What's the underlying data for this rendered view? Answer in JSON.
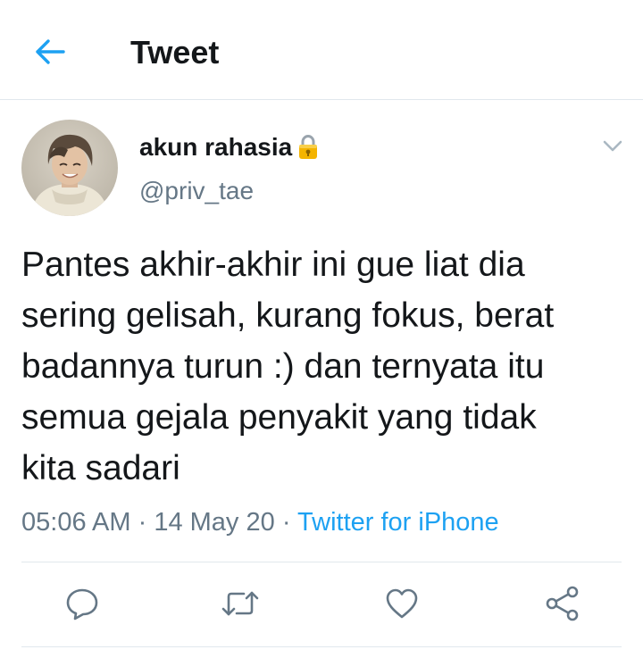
{
  "header": {
    "title": "Tweet",
    "back_icon": "arrow-left-icon"
  },
  "tweet": {
    "author": {
      "display_name": "akun rahasia",
      "username": "@priv_tae",
      "badge_icon": "lock-emoji-icon"
    },
    "text": "Pantes akhir-akhir ini gue liat dia\nsering gelisah, kurang fokus, berat\nbadannya turun :) dan ternyata itu\nsemua gejala penyakit yang tidak\nkita sadari",
    "time": "05:06 AM",
    "date": "14 May 20",
    "separator": "·",
    "source": "Twitter for iPhone"
  },
  "actions": [
    {
      "name": "reply",
      "icon": "reply-icon"
    },
    {
      "name": "retweet",
      "icon": "retweet-icon"
    },
    {
      "name": "like",
      "icon": "heart-icon"
    },
    {
      "name": "share",
      "icon": "share-icon"
    }
  ],
  "colors": {
    "accent": "#1da1f2",
    "text_primary": "#14171a",
    "text_secondary": "#657786",
    "divider": "#e1e8ed"
  }
}
